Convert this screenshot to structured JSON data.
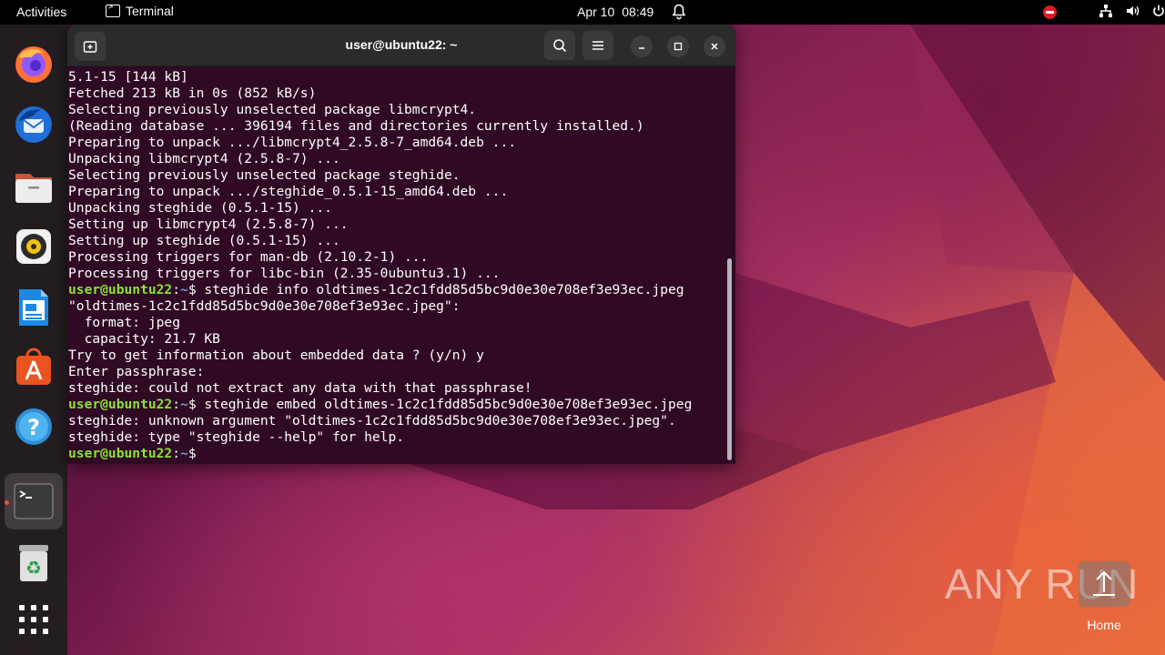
{
  "topbar": {
    "activities": "Activities",
    "app_name": "Terminal",
    "date": "Apr 10",
    "time": "08:49"
  },
  "dock": {
    "apps": [
      "firefox-icon",
      "thunderbird-icon",
      "files-icon",
      "rhythmbox-icon",
      "writer-icon",
      "software-icon",
      "help-icon",
      "terminal-icon",
      "trash-icon",
      "app-grid-icon"
    ]
  },
  "terminal": {
    "title": "user@ubuntu22: ~",
    "lines": [
      {
        "text": "5.1-15 [144 kB]"
      },
      {
        "text": "Fetched 213 kB in 0s (852 kB/s)"
      },
      {
        "text": "Selecting previously unselected package libmcrypt4."
      },
      {
        "text": "(Reading database ... 396194 files and directories currently installed.)"
      },
      {
        "text": "Preparing to unpack .../libmcrypt4_2.5.8-7_amd64.deb ..."
      },
      {
        "text": "Unpacking libmcrypt4 (2.5.8-7) ..."
      },
      {
        "text": "Selecting previously unselected package steghide."
      },
      {
        "text": "Preparing to unpack .../steghide_0.5.1-15_amd64.deb ..."
      },
      {
        "text": "Unpacking steghide (0.5.1-15) ..."
      },
      {
        "text": "Setting up libmcrypt4 (2.5.8-7) ..."
      },
      {
        "text": "Setting up steghide (0.5.1-15) ..."
      },
      {
        "text": "Processing triggers for man-db (2.10.2-1) ..."
      },
      {
        "text": "Processing triggers for libc-bin (2.35-0ubuntu3.1) ..."
      },
      {
        "user": "user@ubuntu22",
        "path": "~",
        "command": " steghide info oldtimes-1c2c1fdd85d5bc9d0e30e708ef3e93ec.jpeg"
      },
      {
        "text": "\"oldtimes-1c2c1fdd85d5bc9d0e30e708ef3e93ec.jpeg\":"
      },
      {
        "text": "  format: jpeg"
      },
      {
        "text": "  capacity: 21.7 KB"
      },
      {
        "text": "Try to get information about embedded data ? (y/n) y"
      },
      {
        "text": "Enter passphrase:"
      },
      {
        "text": "steghide: could not extract any data with that passphrase!"
      },
      {
        "user": "user@ubuntu22",
        "path": "~",
        "command": " steghide embed oldtimes-1c2c1fdd85d5bc9d0e30e708ef3e93ec.jpeg"
      },
      {
        "text": "steghide: unknown argument \"oldtimes-1c2c1fdd85d5bc9d0e30e708ef3e93ec.jpeg\"."
      },
      {
        "text": "steghide: type \"steghide --help\" for help."
      },
      {
        "user": "user@ubuntu22",
        "path": "~",
        "command": ""
      }
    ]
  },
  "desktop": {
    "watermark": "ANY RUN",
    "home_label": "Home"
  }
}
